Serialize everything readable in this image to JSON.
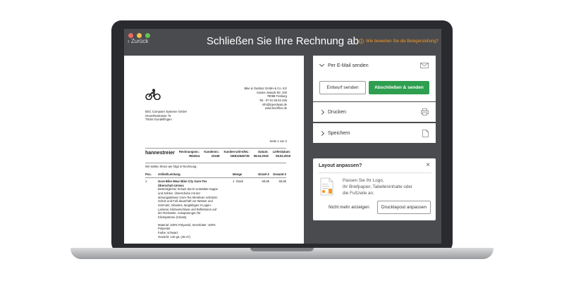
{
  "window": {
    "dot_colors": [
      "#ec6a5e",
      "#f4bf4f",
      "#61c554"
    ]
  },
  "topbar": {
    "back_label": "Zurück",
    "title": "Schließen Sie Ihre Rechnung ab",
    "feedback_label": "Wie bewerten Sie die Belegerstellung?",
    "accent": "#f59a23"
  },
  "invoice": {
    "sender_address": [
      "Bike & Outdoor GmbH & Co. KG",
      "Kaiser-Joseph-Str. 100",
      "79098 Freiburg",
      "Tel.: 07 61 55 63 426",
      "info@rgendwas.de",
      "www.lexoffice.de"
    ],
    "recipient_address": [
      "BSC Computer Systeme GmbH",
      "Gewerbestrasse 75",
      "79194 Gundelfingen"
    ],
    "page_info": "Seite 1 von 2",
    "heading": "hannestreier",
    "meta_labels": [
      "Rechnungsnr.:",
      "Kundennr.:",
      "Kunden-USt-IdNr.:",
      "Datum:",
      "Lieferdatum:"
    ],
    "meta_values": [
      "RE4514",
      "10248",
      "DE812649735",
      "08.04.2019",
      "08.04.2019"
    ],
    "intro": "Wir stellen Ihnen wie folgt in Rechnung:",
    "columns": [
      "Pos.",
      "Artikel/Leistung",
      "Menge",
      "Einzel €",
      "Gesamt €"
    ],
    "item": {
      "pos": "1",
      "name": "Gore Bike Wear Bike City Gore-Tex Überschuh Unisex",
      "description": [
        "Bestmöglicher Schutz durch verstärkte Kappe",
        "und Sohlen. Überschuhe mit der",
        "atmungsaktiven Gore-Tex Membran schützen",
        "Schuh und Fuß dauerhaft vor Wasser und",
        "Schmutz; robustes, langlebiges 3-Lagen-",
        "Laminat. Klettverschluss und Reflektoren auf",
        "der Rückseite. Aussparungen für",
        "Klicksysteme (Cleats)."
      ],
      "details": [
        "Material: 100% Polyamid, Innenfutter: 100%",
        "Polyester",
        "Farbe: schwarz",
        "Gewicht: 140 g/L (45-47)"
      ],
      "quantity": "1",
      "unit": "Stück",
      "unit_price": "69,95",
      "total": "69,95"
    }
  },
  "panel": {
    "email_label": "Per E-Mail senden",
    "draft_button": "Entwurf senden",
    "finish_button": "Abschließen & senden",
    "print_label": "Drucken",
    "save_label": "Speichern",
    "primary_color": "#2e9e4f"
  },
  "layout_popup": {
    "title": "Layout anpassen?",
    "text_lines": [
      "Passen Sie Ihr Logo,",
      "Ihr Briefpapier, Tabelleninhalte oder",
      "die Fußzeile an."
    ],
    "dismiss_label": "Nicht mehr anzeigen",
    "action_label": "Drucklayout anpassen"
  }
}
